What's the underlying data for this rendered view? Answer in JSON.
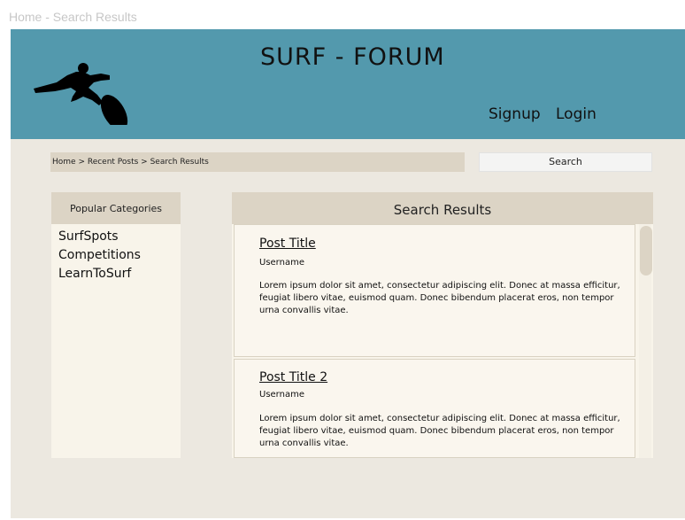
{
  "frame_title": "Home - Search Results",
  "header": {
    "logo_icon": "surfer-logo-icon",
    "site_title": "SURF - FORUM",
    "signup_label": "Signup",
    "login_label": "Login",
    "color": "#5399ad"
  },
  "breadcrumb": "Home > Recent Posts > Search Results",
  "search_button": "Search",
  "sidebar": {
    "title": "Popular Categories",
    "categories": [
      "SurfSpots",
      "Competitions",
      "LearnToSurf"
    ]
  },
  "results": {
    "title": "Search Results",
    "posts": [
      {
        "title": "Post Title",
        "username": "Username",
        "body": "Lorem ipsum dolor sit amet, consectetur adipiscing elit. Donec at massa efficitur, feugiat libero vitae, euismod quam. Donec bibendum placerat eros, non tempor urna convallis vitae."
      },
      {
        "title": "Post Title 2",
        "username": "Username",
        "body": "Lorem ipsum dolor sit amet, consectetur adipiscing elit. Donec at massa efficitur, feugiat libero vitae, euismod quam. Donec bibendum placerat eros, non tempor urna convallis vitae."
      }
    ]
  }
}
